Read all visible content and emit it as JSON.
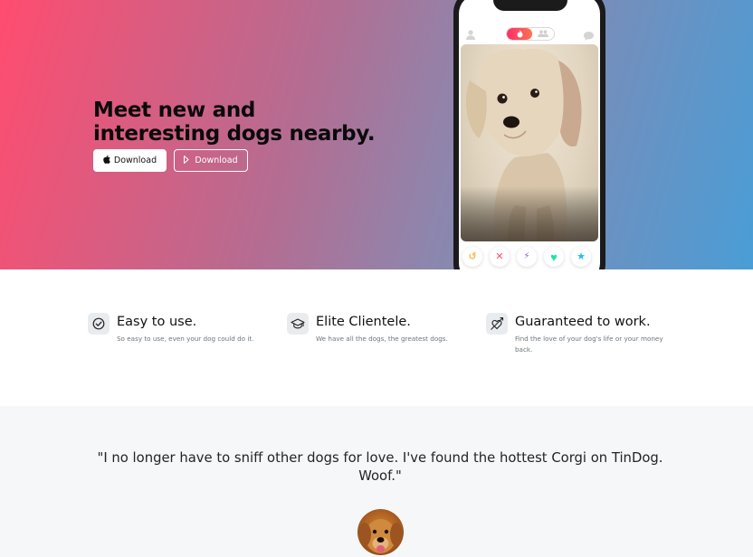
{
  "hero": {
    "title": "Meet new and interesting dogs nearby.",
    "apple_download_label": "Download",
    "google_download_label": "Download",
    "apple_icon": "apple-icon",
    "play_icon": "google-play-icon"
  },
  "phone": {
    "profile_icon": "person-icon",
    "chat_icon": "chat-bubble-icon",
    "toggle_active_icon": "flame-icon",
    "toggle_inactive_icon": "group-icon",
    "photo": "dog-photo",
    "actions": [
      {
        "icon": "rewind-icon",
        "glyph": "↺",
        "color": "#f5b748"
      },
      {
        "icon": "nope-icon",
        "glyph": "✕",
        "color": "#fd5068"
      },
      {
        "icon": "boost-icon",
        "glyph": "⚡",
        "color": "#915dd1"
      },
      {
        "icon": "like-icon",
        "glyph": "♥",
        "color": "#1be4a1"
      },
      {
        "icon": "super-like-icon",
        "glyph": "★",
        "color": "#2db8f1"
      }
    ]
  },
  "features": [
    {
      "icon": "circle-check-icon",
      "title": "Easy to use.",
      "text": "So easy to use, even your dog could do it."
    },
    {
      "icon": "graduation-cap-icon",
      "title": "Elite Clientele.",
      "text": "We have all the dogs, the greatest dogs."
    },
    {
      "icon": "heart-arrow-icon",
      "title": "Guaranteed to work.",
      "text": "Find the love of your dog's life or your money back."
    }
  ],
  "testimonial": {
    "quote": "\"I no longer have to sniff other dogs for love. I've found the hottest Corgi on TinDog. Woof.\"",
    "avatar": "dog-avatar"
  },
  "colors": {
    "gradient_start": "#ff4c6f",
    "gradient_end": "#4a9dd6",
    "testimonial_bg": "#f6f7f9"
  }
}
